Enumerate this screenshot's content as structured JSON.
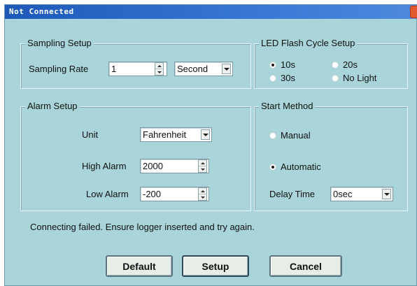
{
  "window": {
    "title": "Not Connected"
  },
  "sampling_setup": {
    "legend": "Sampling Setup",
    "rate_label": "Sampling Rate",
    "rate_value": "1",
    "unit_value": "Second"
  },
  "led_flash": {
    "legend": "LED Flash Cycle Setup",
    "options": [
      "10s",
      "20s",
      "30s",
      "No Light"
    ],
    "selected": "10s"
  },
  "alarm_setup": {
    "legend": "Alarm Setup",
    "unit_label": "Unit",
    "unit_value": "Fahrenheit",
    "high_label": "High Alarm",
    "high_value": "2000",
    "low_label": "Low Alarm",
    "low_value": "-200"
  },
  "start_method": {
    "legend": "Start Method",
    "options": [
      "Manual",
      "Automatic"
    ],
    "selected": "Automatic",
    "delay_label": "Delay Time",
    "delay_value": "0sec"
  },
  "status": {
    "message": "Connecting failed. Ensure logger inserted and try again."
  },
  "buttons": {
    "default": "Default",
    "setup": "Setup",
    "cancel": "Cancel"
  },
  "colors": {
    "dialog_bg": "#a9d5da",
    "titlebar": "#2a66c6",
    "close": "#e2582f"
  }
}
